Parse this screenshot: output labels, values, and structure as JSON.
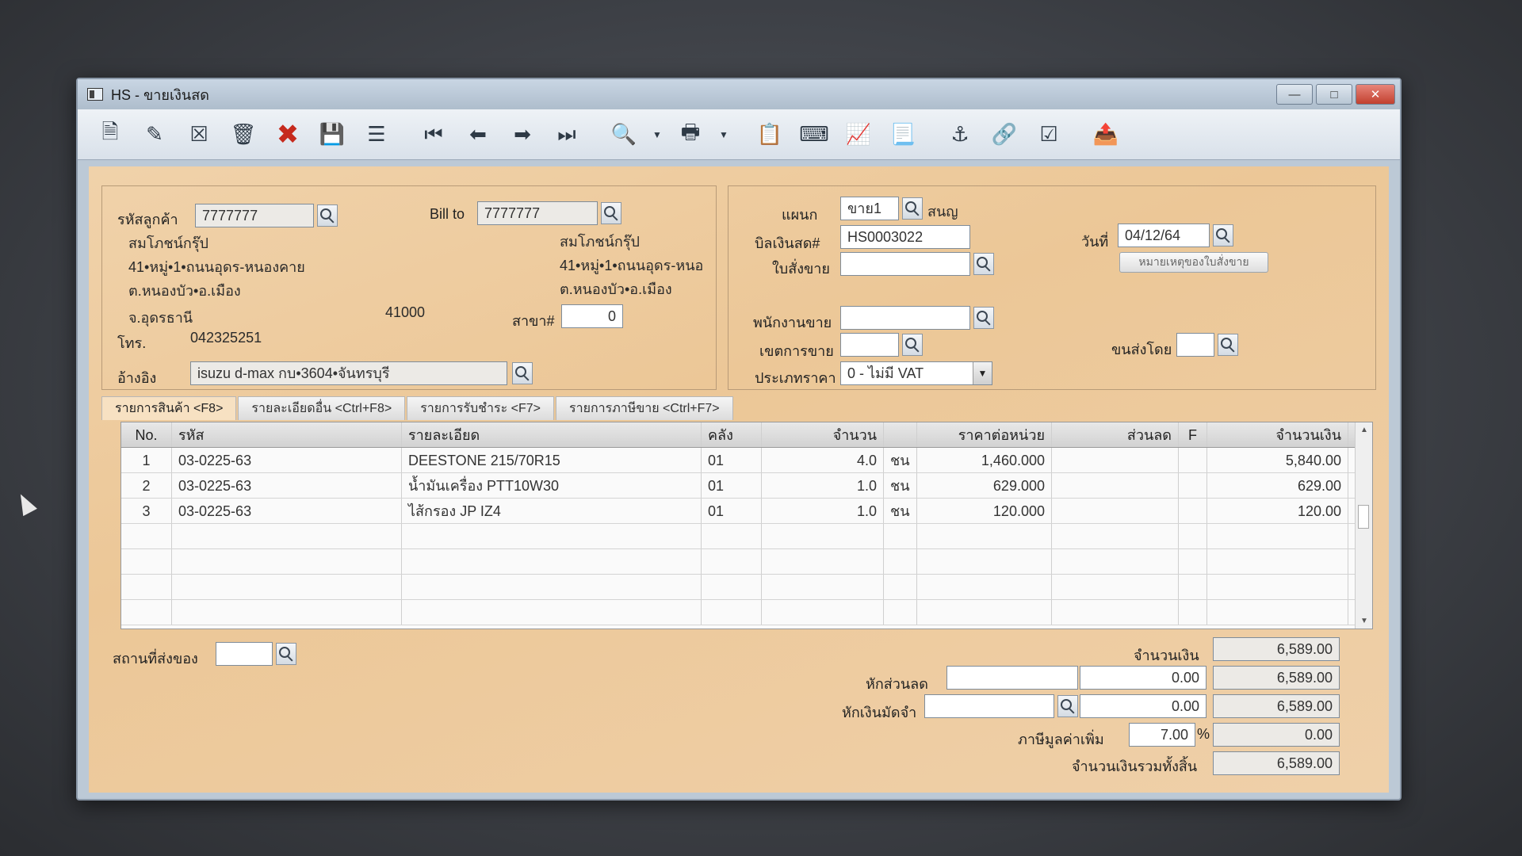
{
  "window": {
    "title": "HS - ขายเงินสด"
  },
  "toolbar": {
    "icons": [
      "new-doc-icon",
      "edit-icon",
      "void-icon",
      "trash-icon",
      "cancel-icon",
      "save-icon",
      "stack-icon",
      "first-record-icon",
      "prev-record-icon",
      "next-record-icon",
      "last-record-icon",
      "find-icon",
      "print-icon",
      "note-icon",
      "keyboard-icon",
      "so-icon",
      "report-icon",
      "approve-icon",
      "link-icon",
      "ok-doc-icon",
      "export-icon"
    ]
  },
  "customer": {
    "code_label": "รหัสลูกค้า",
    "code": "7777777",
    "name": "สมโภชน์กรุ๊ป",
    "addr1": "41•หมู่•1•ถนนอุดร-หนองคาย",
    "addr2": "ต.หนองบัว•อ.เมือง",
    "province": "จ.อุดรธานี",
    "zip": "41000",
    "tel_label": "โทร.",
    "tel": "042325251",
    "ref_label": "อ้างอิง",
    "ref": "isuzu d-max กบ•3604•จันทรบุรี"
  },
  "billto": {
    "label": "Bill to",
    "code": "7777777",
    "name": "สมโภชน์กรุ๊ป",
    "addr1": "41•หมู่•1•ถนนอุดร-หนอ",
    "addr2": "ต.หนองบัว•อ.เมือง",
    "branch_label": "สาขา#",
    "branch": "0"
  },
  "doc": {
    "dept_label": "แผนก",
    "dept": "ขาย1",
    "dept_name": "สนญ",
    "bill_label": "บิลเงินสด#",
    "bill": "HS0003022",
    "date_label": "วันที่",
    "date": "04/12/64",
    "so_label": "ใบสั่งขาย",
    "so": "",
    "so_note_btn": "หมายเหตุของใบสั่งขาย",
    "sales_label": "พนักงานขาย",
    "sales": "",
    "area_label": "เขตการขาย",
    "area": "",
    "ship_label": "ขนส่งโดย",
    "ship": "",
    "price_type_label": "ประเภทราคา",
    "price_type": "0 - ไม่มี VAT"
  },
  "tabs": [
    "รายการสินค้า <F8>",
    "รายละเอียดอื่น <Ctrl+F8>",
    "รายการรับชำระ <F7>",
    "รายการภาษีขาย <Ctrl+F7>"
  ],
  "grid": {
    "headers": [
      "No.",
      "รหัส",
      "รายละเอียด",
      "คลัง",
      "จำนวน",
      "",
      "ราคาต่อหน่วย",
      "ส่วนลด",
      "F",
      "จำนวนเงิน"
    ],
    "rows": [
      [
        "1",
        "03-0225-63",
        "DEESTONE 215/70R15",
        "01",
        "4.0",
        "ชน",
        "1,460.000",
        "",
        "",
        "5,840.00"
      ],
      [
        "2",
        "03-0225-63",
        "น้ำมันเครื่อง PTT10W30",
        "01",
        "1.0",
        "ชน",
        "629.000",
        "",
        "",
        "629.00"
      ],
      [
        "3",
        "03-0225-63",
        "ไส้กรอง JP IZ4",
        "01",
        "1.0",
        "ชน",
        "120.000",
        "",
        "",
        "120.00"
      ]
    ]
  },
  "footer": {
    "ship_place_label": "สถานที่ส่งของ",
    "ship_place": "",
    "amount_label": "จำนวนเงิน",
    "amount": "6,589.00",
    "discount_label": "หักส่วนลด",
    "discount_input": "",
    "discount_value": "0.00",
    "after_discount": "6,589.00",
    "deposit_label": "หักเงินมัดจำ",
    "deposit_input": "",
    "deposit_value": "0.00",
    "after_deposit": "6,589.00",
    "vat_label": "ภาษีมูลค่าเพิ่ม",
    "vat_rate": "7.00",
    "vat_pct": "%",
    "vat_amount": "0.00",
    "total_label": "จำนวนเงินรวมทั้งสิ้น",
    "total": "6,589.00"
  }
}
